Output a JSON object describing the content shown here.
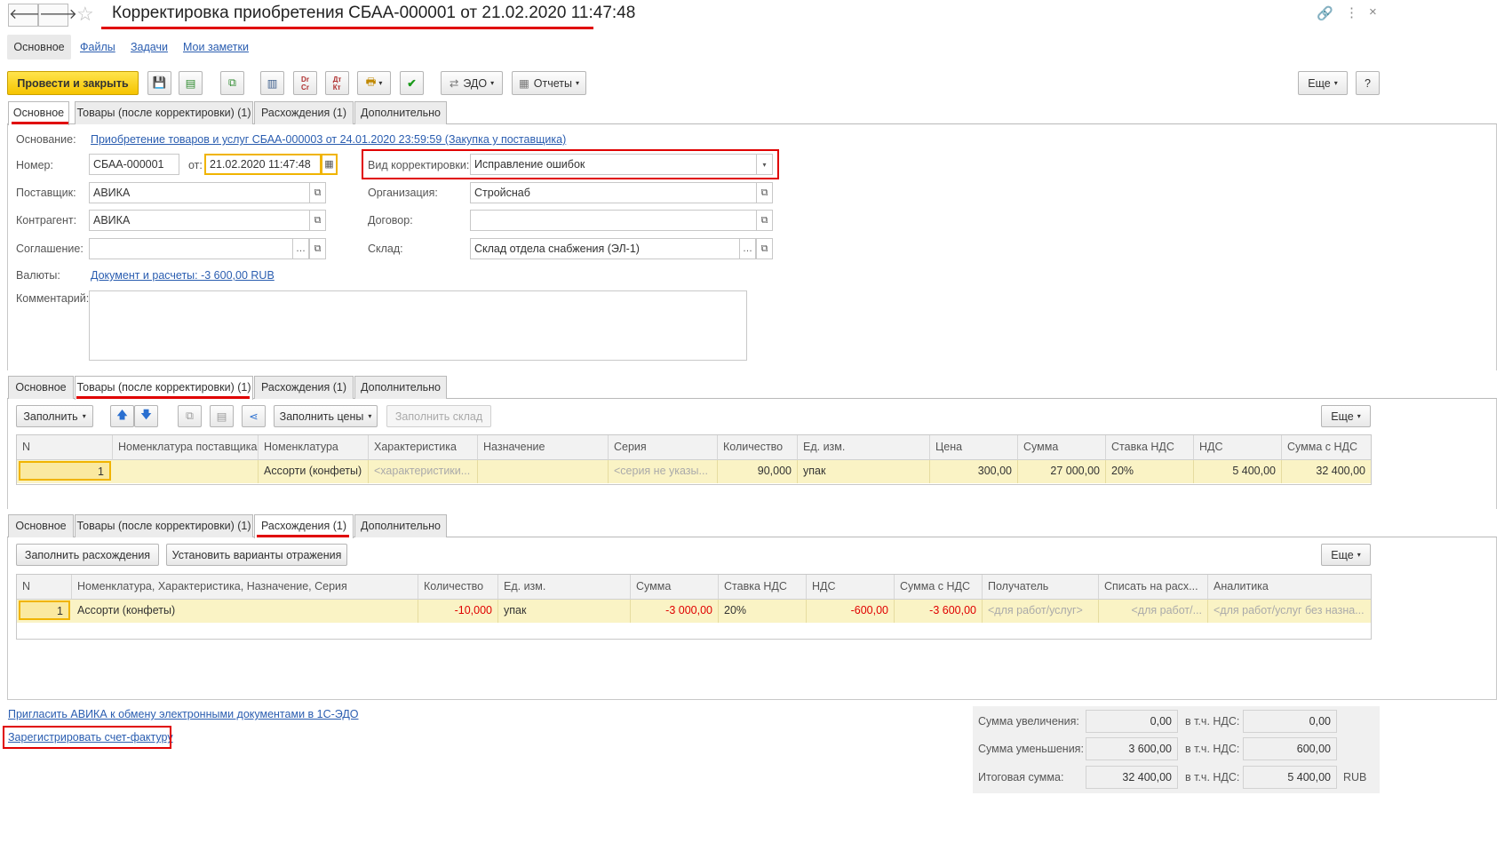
{
  "header": {
    "title": "Корректировка приобретения СБАА-000001 от 21.02.2020 11:47:48",
    "nav_links": [
      "Основное",
      "Файлы",
      "Задачи",
      "Мои заметки"
    ]
  },
  "toolbar": {
    "post_close": "Провести и закрыть",
    "edo": "ЭДО",
    "reports": "Отчеты",
    "more": "Еще",
    "help": "?"
  },
  "tabs": [
    "Основное",
    "Товары (после корректировки) (1)",
    "Расхождения (1)",
    "Дополнительно"
  ],
  "main": {
    "basis_label": "Основание:",
    "basis_link": "Приобретение товаров и услуг СБАА-000003 от 24.01.2020 23:59:59 (Закупка у поставщика)",
    "number_label": "Номер:",
    "number": "СБАА-000001",
    "from_label": "от:",
    "date": "21.02.2020 11:47:48",
    "kind_label": "Вид корректировки:",
    "kind": "Исправление ошибок",
    "supplier_label": "Поставщик:",
    "supplier": "АВИКА",
    "org_label": "Организация:",
    "org": "Стройснаб",
    "counterparty_label": "Контрагент:",
    "counterparty": "АВИКА",
    "contract_label": "Договор:",
    "contract": "",
    "agreement_label": "Соглашение:",
    "agreement": "",
    "warehouse_label": "Склад:",
    "warehouse": "Склад отдела снабжения (ЭЛ-1)",
    "currency_label": "Валюты:",
    "currency_link": "Документ и расчеты: -3 600,00 RUB",
    "comment_label": "Комментарий:",
    "comment": ""
  },
  "goods": {
    "fill": "Заполнить",
    "fill_prices": "Заполнить цены",
    "fill_warehouse": "Заполнить склад",
    "more": "Еще",
    "columns": [
      "N",
      "Номенклатура поставщика",
      "Номенклатура",
      "Характеристика",
      "Назначение",
      "Серия",
      "Количество",
      "Ед. изм.",
      "Цена",
      "Сумма",
      "Ставка НДС",
      "НДС",
      "Сумма с НДС"
    ],
    "rows": [
      [
        "1",
        "",
        "Ассорти (конфеты)",
        "<характеристики...",
        "",
        "<серия не указы...",
        "90,000",
        "упак",
        "300,00",
        "27 000,00",
        "20%",
        "5 400,00",
        "32 400,00"
      ]
    ]
  },
  "diffs": {
    "fill": "Заполнить расхождения",
    "set_variants": "Установить варианты отражения",
    "more": "Еще",
    "columns": [
      "N",
      "Номенклатура, Характеристика, Назначение, Серия",
      "Количество",
      "Ед. изм.",
      "Сумма",
      "Ставка НДС",
      "НДС",
      "Сумма с НДС",
      "Получатель",
      "Списать на расх...",
      "Аналитика"
    ],
    "rows": [
      [
        "1",
        "Ассорти (конфеты)",
        "-10,000",
        "упак",
        "-3 000,00",
        "20%",
        "-600,00",
        "-3 600,00",
        "<для работ/услуг>",
        "<для работ/...",
        "<для работ/услуг без назна..."
      ]
    ]
  },
  "footer": {
    "invite_link": "Пригласить АВИКА к обмену электронными документами в 1С-ЭДО",
    "invoice_link": "Зарегистрировать счет-фактуру",
    "increase_label": "Сумма увеличения:",
    "increase": "0,00",
    "increase_vat": "0,00",
    "decrease_label": "Сумма уменьшения:",
    "decrease": "3 600,00",
    "decrease_vat": "600,00",
    "total_label": "Итоговая сумма:",
    "total": "32 400,00",
    "total_vat": "5 400,00",
    "vat_label": "в т.ч. НДС:",
    "currency": "RUB"
  }
}
